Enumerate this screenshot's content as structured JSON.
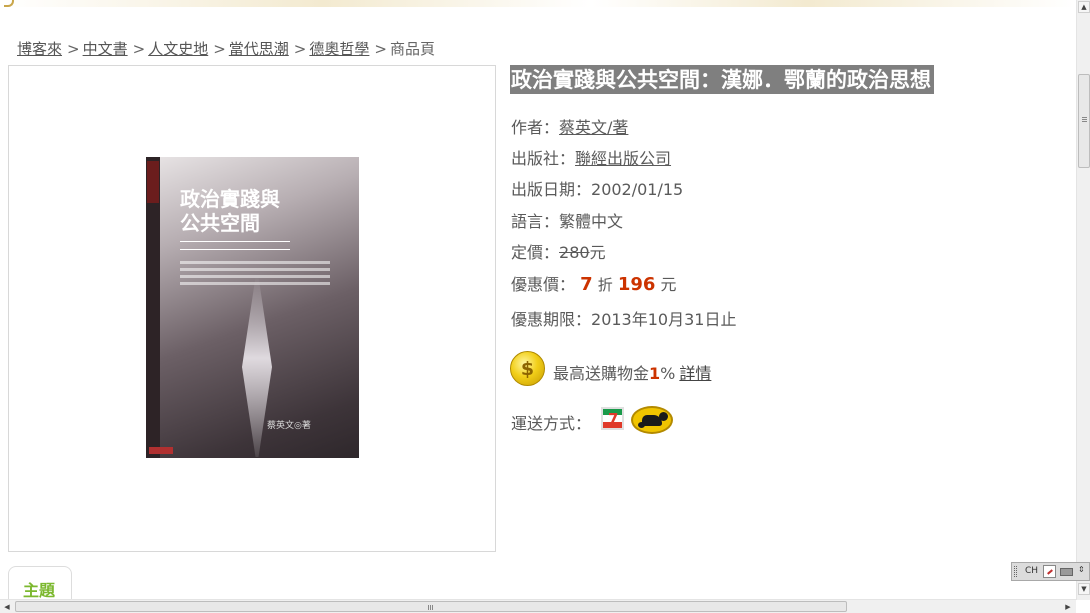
{
  "breadcrumb": {
    "items": [
      "博客來",
      "中文書",
      "人文史地",
      "當代思潮",
      "德奧哲學"
    ],
    "separator": ">",
    "current": "商品頁"
  },
  "book_cover": {
    "title_line1": "政治實踐與",
    "title_line2": "公共空間",
    "author": "蔡英文◎著"
  },
  "product": {
    "title": "政治實踐與公共空間：漢娜．鄂蘭的政治思想",
    "author_label": "作者：",
    "author_value": "蔡英文/著",
    "publisher_label": "出版社：",
    "publisher_value": "聯經出版公司",
    "pub_date_label": "出版日期：",
    "pub_date_value": "2002/01/15",
    "language_label": "語言：",
    "language_value": "繁體中文",
    "list_price_label": "定價：",
    "list_price_value": "280",
    "currency": "元",
    "sale_price_label": "優惠價：",
    "discount_value": "7",
    "discount_unit": "折",
    "sale_price_value": "196",
    "promo_deadline_label": "優惠期限：",
    "promo_deadline_value": "2013年10月31日止"
  },
  "reward": {
    "icon": "dollar-coin-icon",
    "text_prefix": "最高送購物金",
    "percent_number": "1",
    "percent_sign": "%",
    "details_link": "詳情"
  },
  "shipping": {
    "label": "運送方式：",
    "methods": [
      "7-eleven-icon",
      "black-cat-delivery-icon"
    ]
  },
  "tabs": {
    "subject_label": "主題"
  },
  "cover_seven_digit": "7",
  "ime": {
    "language": "CH"
  },
  "colors": {
    "title_bg": "#7f7f7f",
    "discount_red": "#cc3300",
    "tab_green": "#7cb82f",
    "coin_gold": "#f2cf19"
  }
}
